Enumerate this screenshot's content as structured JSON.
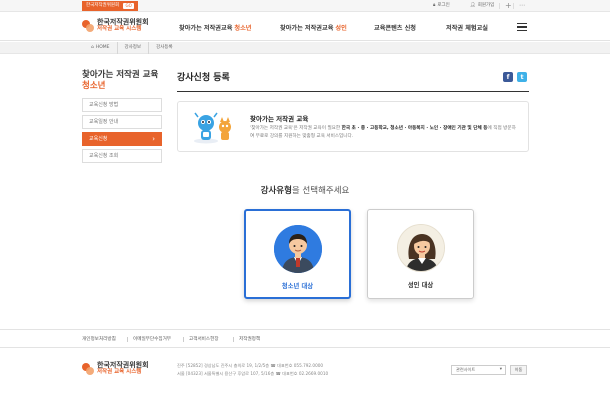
{
  "topbar": {
    "site_tab": "한국저작권위원회",
    "site_tab_chevron": "GO",
    "login": "로그인",
    "signup": "회원가입"
  },
  "header": {
    "logo_line1": "한국저작권위원회",
    "logo_line2": "저작권 교육 시스템",
    "nav": [
      {
        "label": "찾아가는 저작권교육",
        "highlight": "청소년"
      },
      {
        "label": "찾아가는 저작권교육",
        "highlight": "성인"
      },
      {
        "label": "교육콘텐츠 신청",
        "highlight": ""
      },
      {
        "label": "저작권 체험교실",
        "highlight": ""
      }
    ]
  },
  "breadcrumb": [
    "HOME",
    "강사정보",
    "강사등록"
  ],
  "sidebar": {
    "title": "찾아가는 저작권 교육",
    "title_highlight": "청소년",
    "items": [
      {
        "label": "교육신청 방법",
        "active": false
      },
      {
        "label": "교육일정 안내",
        "active": false
      },
      {
        "label": "교육신청",
        "active": true
      },
      {
        "label": "교육신청 조회",
        "active": false
      }
    ]
  },
  "main": {
    "title": "강사신청 등록",
    "share_facebook": "f",
    "share_twitter": "t",
    "info_title": "찾아가는 저작권 교육",
    "info_desc_pre": "'찾아가는 저작권 교육'은 저작권 교육이 필요한 ",
    "info_desc_bold1": "한국 초 · 중 · 고등학교, 청소년 · 아동복지 · 노인 · 장애인 기관 및 단체 등",
    "info_desc_post": "에 직접 방문하여 무료로 강의를 지원하는 맞춤형 교육 서비스입니다.",
    "select_heading_bold": "강사유형",
    "select_heading_rest": "을 선택해주세요",
    "cards": [
      {
        "label": "청소년 대상",
        "selected": true
      },
      {
        "label": "성인 대상",
        "selected": false
      }
    ]
  },
  "footer": {
    "links": [
      "개인정보처리방침",
      "이메일무단수집거부",
      "고객서비스헌장",
      "저작권정책"
    ],
    "logo_line1": "한국저작권위원회",
    "logo_line2": "저작권 교육 시스템",
    "address1": "진주 [52852] 경상남도 진주시 충의로 19, 1/2/5층   ☎ 대표번호 055.792.0000",
    "address2": "서울 [04323] 서울특별시 용산구 후암로 107, 5/16층   ☎ 대표번호 02.2669.0010",
    "family_select": "관련사이트",
    "go_button": "이동"
  },
  "colors": {
    "accent": "#e8632b",
    "selected_blue": "#2a6fd6",
    "facebook": "#3b5998",
    "twitter": "#3fb1e8"
  }
}
